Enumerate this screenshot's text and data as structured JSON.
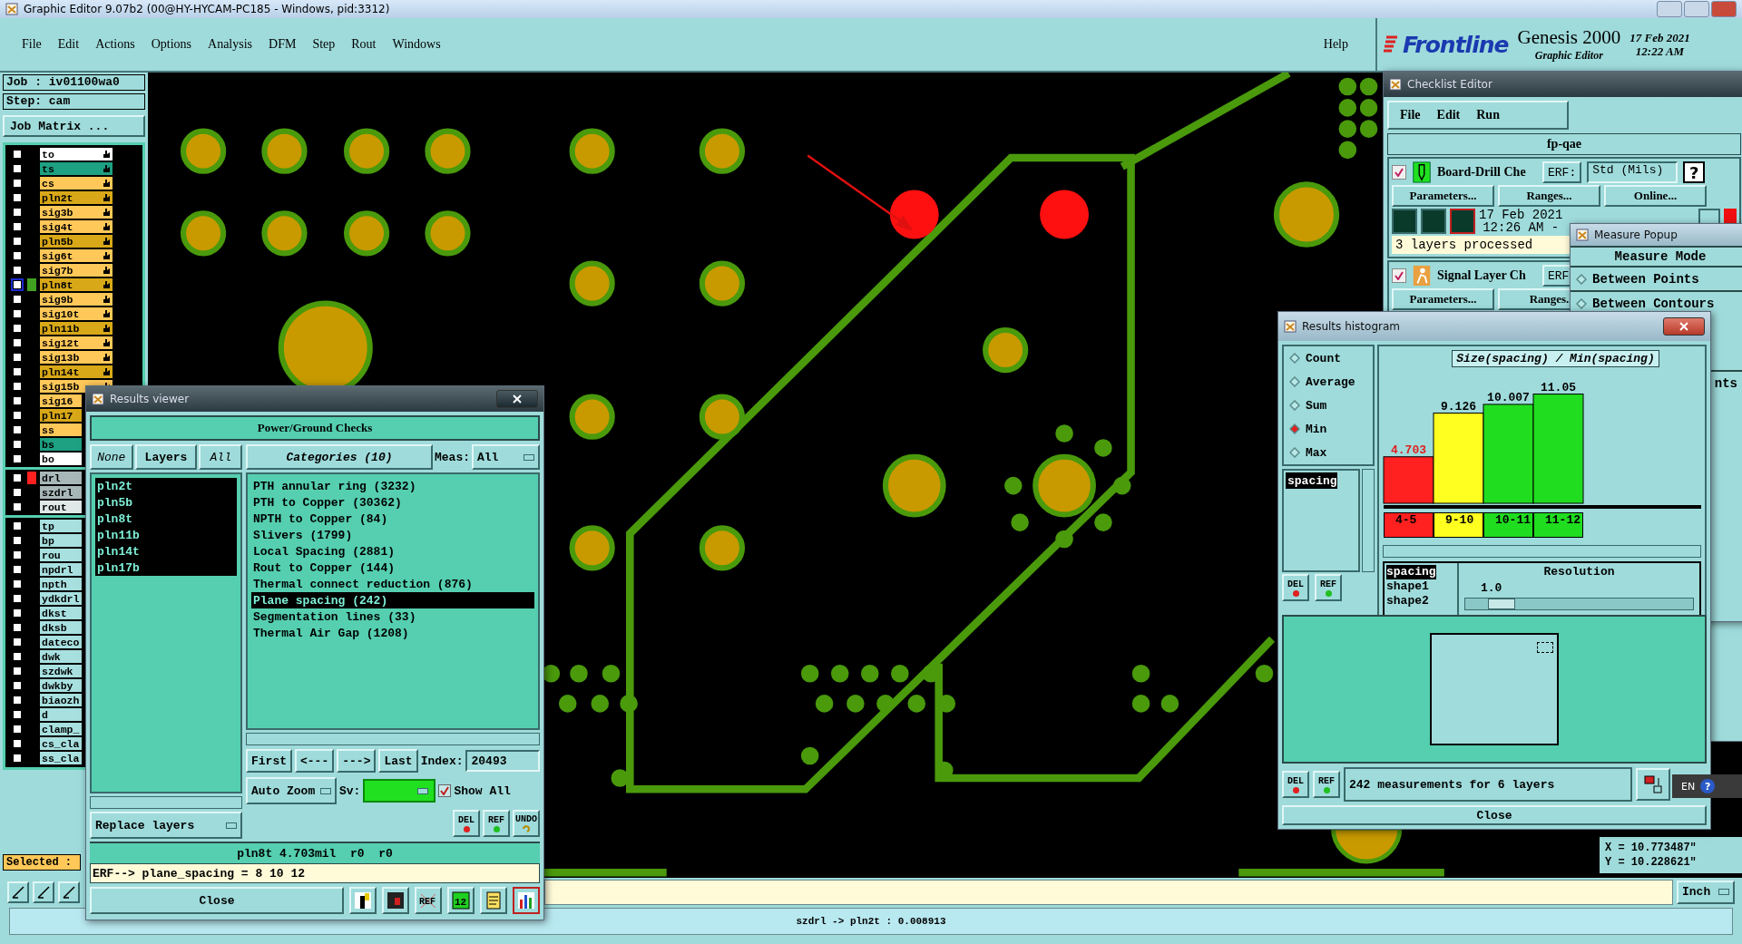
{
  "title_bar": {
    "title": "Graphic Editor 9.07b2 (00@HY-HYCAM-PC185 - Windows, pid:3312)"
  },
  "menu": [
    {
      "label": "File"
    },
    {
      "label": "Edit"
    },
    {
      "label": "Actions"
    },
    {
      "label": "Options"
    },
    {
      "label": "Analysis"
    },
    {
      "label": "DFM"
    },
    {
      "label": "Step"
    },
    {
      "label": "Rout"
    },
    {
      "label": "Windows"
    }
  ],
  "help": "Help",
  "brand": {
    "logo": "Frontline",
    "product": "Genesis 2000",
    "subtitle": "Graphic Editor",
    "date": "17 Feb 2021",
    "time": "12:22 AM"
  },
  "job": {
    "job": "Job : iv01100wa0",
    "step": "Step: cam",
    "matrix_button": "Job Matrix ..."
  },
  "layer_groups": [
    {
      "layers": [
        {
          "name": "to",
          "color": "#ffffff",
          "checked": false,
          "hand": true
        },
        {
          "name": "ts",
          "color": "#1ea082",
          "checked": false,
          "hand": true
        },
        {
          "name": "cs",
          "color": "#ffc858",
          "checked": false,
          "hand": true
        },
        {
          "name": "pln2t",
          "color": "#d8a818",
          "checked": false,
          "hand": true
        },
        {
          "name": "sig3b",
          "color": "#ffc858",
          "checked": false,
          "hand": true
        },
        {
          "name": "sig4t",
          "color": "#ffc858",
          "checked": false,
          "hand": true
        },
        {
          "name": "pln5b",
          "color": "#d8a818",
          "checked": false,
          "hand": true
        },
        {
          "name": "sig6t",
          "color": "#ffc858",
          "checked": false,
          "hand": true
        },
        {
          "name": "sig7b",
          "color": "#ffc858",
          "checked": false,
          "hand": true
        },
        {
          "name": "pln8t",
          "color": "#d8a818",
          "checked": false,
          "hand": true,
          "work": true,
          "marker": {
            "color": "#40a020"
          }
        },
        {
          "name": "sig9b",
          "color": "#ffc858",
          "checked": false,
          "hand": true
        },
        {
          "name": "sig10t",
          "color": "#ffc858",
          "checked": false,
          "hand": true
        },
        {
          "name": "pln11b",
          "color": "#d8a818",
          "checked": false,
          "hand": true
        },
        {
          "name": "sig12t",
          "color": "#ffc858",
          "checked": false,
          "hand": true
        },
        {
          "name": "sig13b",
          "color": "#ffc858",
          "checked": false,
          "hand": true
        },
        {
          "name": "pln14t",
          "color": "#d8a818",
          "checked": false,
          "hand": true
        },
        {
          "name": "sig15b",
          "color": "#ffc858",
          "checked": false,
          "hand": true
        },
        {
          "name": "sig16",
          "color": "#ffc858",
          "checked": false
        },
        {
          "name": "pln17",
          "color": "#d8a818",
          "checked": false
        },
        {
          "name": "ss",
          "color": "#ffc858",
          "checked": false
        },
        {
          "name": "bs",
          "color": "#1ea082",
          "checked": false
        },
        {
          "name": "bo",
          "color": "#ffffff",
          "checked": false
        }
      ]
    },
    {
      "layers": [
        {
          "name": "drl",
          "color": "#a8b8b8",
          "checked": false,
          "marker": {
            "color": "#ff2020"
          }
        },
        {
          "name": "szdrl",
          "color": "#a8b8b8",
          "checked": false
        },
        {
          "name": "rout",
          "color": "#e0e8e8",
          "checked": false
        }
      ]
    },
    {
      "layers": [
        {
          "name": "tp",
          "color": "#a8e0e0",
          "checked": false
        },
        {
          "name": "bp",
          "color": "#a8e0e0",
          "checked": false
        },
        {
          "name": "rou",
          "color": "#a8e0e0",
          "checked": false
        },
        {
          "name": "npdrl",
          "color": "#a8e0e0",
          "checked": false
        },
        {
          "name": "npth",
          "color": "#a8e0e0",
          "checked": false
        },
        {
          "name": "ydkdrl",
          "color": "#a8e0e0",
          "checked": false
        },
        {
          "name": "dkst",
          "color": "#a8e0e0",
          "checked": false
        },
        {
          "name": "dksb",
          "color": "#a8e0e0",
          "checked": false
        },
        {
          "name": "dateco",
          "color": "#a8e0e0",
          "checked": false
        },
        {
          "name": "dwk",
          "color": "#a8e0e0",
          "checked": false
        },
        {
          "name": "szdwk",
          "color": "#a8e0e0",
          "checked": false
        },
        {
          "name": "dwkby",
          "color": "#a8e0e0",
          "checked": false
        },
        {
          "name": "biaozh",
          "color": "#a8e0e0",
          "checked": false
        },
        {
          "name": "d",
          "color": "#a8e0e0",
          "checked": false
        },
        {
          "name": "clamp_",
          "color": "#a8e0e0",
          "checked": false
        },
        {
          "name": "cs_cla",
          "color": "#a8e0e0",
          "checked": false
        },
        {
          "name": "ss_cla",
          "color": "#a8e0e0",
          "checked": false
        }
      ]
    }
  ],
  "selected_label": "Selected :",
  "units": "Inch",
  "coordinates": {
    "x": "X = 10.773487\"",
    "y": "Y = 10.228621\""
  },
  "status": "szdrl -> pln2t : 0.008913",
  "results_viewer": {
    "title": "Results viewer",
    "header": "Power/Ground Checks",
    "layer_buttons": [
      {
        "label": "None",
        "kind": "italic"
      },
      {
        "label": "Layers",
        "kind": "bold"
      },
      {
        "label": "All",
        "kind": "italic"
      }
    ],
    "layers": [
      {
        "name": "pln2t",
        "selected": true
      },
      {
        "name": "pln5b",
        "selected": true
      },
      {
        "name": "pln8t",
        "selected": true
      },
      {
        "name": "pln11b",
        "selected": true
      },
      {
        "name": "pln14t",
        "selected": true
      },
      {
        "name": "pln17b",
        "selected": true
      }
    ],
    "categories_button": "Categories (10)",
    "meas_label": "Meas:",
    "meas_value": "All",
    "categories": [
      {
        "label": "PTH annular ring (3232)",
        "selected": false
      },
      {
        "label": "PTH to Copper (30362)",
        "selected": false
      },
      {
        "label": "NPTH to Copper (84)",
        "selected": false
      },
      {
        "label": "Slivers (1799)",
        "selected": false
      },
      {
        "label": "Local Spacing (2881)",
        "selected": false
      },
      {
        "label": "Rout to Copper (144)",
        "selected": false
      },
      {
        "label": "Thermal connect reduction (876)",
        "selected": false
      },
      {
        "label": "Plane spacing (242)",
        "selected": true
      },
      {
        "label": "Segmentation lines (33)",
        "selected": false
      },
      {
        "label": "Thermal Air Gap (1208)",
        "selected": false
      }
    ],
    "nav_buttons": [
      {
        "label": "First"
      },
      {
        "label": "<---"
      },
      {
        "label": "--->"
      },
      {
        "label": "Last"
      }
    ],
    "index_label": "Index:",
    "index_value": "20493",
    "zoom_mode": "Auto Zoom",
    "sv_label": "Sv:",
    "show_all": {
      "label": "Show All",
      "checked": true
    },
    "action_buttons": [
      {
        "label": "DEL",
        "kind": "del"
      },
      {
        "label": "REF",
        "kind": "ref"
      },
      {
        "label": "UNDO",
        "kind": "undo"
      }
    ],
    "replace_mode": "Replace layers",
    "info": "pln8t 4.703mil  r0  r0",
    "erf_line": "ERF--> plane_spacing = 8 10 12",
    "close": "Close",
    "tools": [
      {
        "kind": "figure",
        "selected": false
      },
      {
        "kind": "exit",
        "selected": false
      },
      {
        "kind": "ref_off",
        "label": "REF",
        "selected": false
      },
      {
        "kind": "numbers",
        "label": "12",
        "selected": false
      },
      {
        "kind": "notes",
        "selected": false
      },
      {
        "kind": "chart",
        "selected": true
      }
    ]
  },
  "checklist_editor": {
    "title": "Checklist Editor",
    "menu": [
      {
        "label": "File"
      },
      {
        "label": "Edit"
      },
      {
        "label": "Run"
      }
    ],
    "checklist": "fp-qae",
    "actions": [
      {
        "checked": true,
        "kind": "drill",
        "name": "Board-Drill Che",
        "erf_label": "ERF:",
        "erf_value": "Std (Mils)",
        "help": "?",
        "buttons": [
          {
            "label": "Parameters..."
          },
          {
            "label": "Ranges..."
          },
          {
            "label": "Online..."
          }
        ],
        "date": "17 Feb 2021",
        "time": "12:26 AM -",
        "status": "3 layers processed"
      },
      {
        "checked": true,
        "kind": "signal",
        "name": "Signal Layer Ch",
        "erf_label": "ERF",
        "buttons": [
          {
            "label": "Parameters..."
          },
          {
            "label": "Ranges."
          }
        ]
      }
    ]
  },
  "measure_popup": {
    "title": "Measure Popup",
    "header": "Measure Mode",
    "modes": [
      {
        "label": "Between Points",
        "selected": false
      },
      {
        "label": "Between Contours",
        "selected": false
      }
    ],
    "partial_option": "nts"
  },
  "histogram": {
    "title": "Results histogram",
    "modes": [
      {
        "label": "Count",
        "selected": false
      },
      {
        "label": "Average",
        "selected": false
      },
      {
        "label": "Sum",
        "selected": false
      },
      {
        "label": "Min",
        "selected": true
      },
      {
        "label": "Max",
        "selected": false
      }
    ],
    "attributes": [
      {
        "label": "spacing",
        "selected": true
      }
    ],
    "side_buttons": [
      {
        "label": "DEL",
        "kind": "del"
      },
      {
        "label": "REF",
        "kind": "ref"
      }
    ],
    "chart_data": {
      "type": "bar",
      "title": "Size(spacing) / Min(spacing)",
      "categories": [
        "4-5",
        "9-10",
        "10-11",
        "11-12"
      ],
      "values": [
        4.703,
        9.126,
        10.007,
        11.05
      ],
      "data_labels": true
    },
    "bins": [
      {
        "color": "#ff2020",
        "alert": true
      },
      {
        "color": "#ffff20",
        "alert": false
      },
      {
        "color": "#20dd20",
        "alert": false
      },
      {
        "color": "#20dd20",
        "alert": false
      }
    ],
    "fields": [
      {
        "label": "spacing",
        "selected": true
      },
      {
        "label": "shape1",
        "selected": false
      },
      {
        "label": "shape2",
        "selected": false
      }
    ],
    "resolution": {
      "label": "Resolution",
      "value": "1.0",
      "level": 0.1
    },
    "footer_buttons": [
      {
        "label": "DEL",
        "kind": "del"
      },
      {
        "label": "REF",
        "kind": "ref"
      }
    ],
    "summary": "242 measurements for 6 layers",
    "close": "Close"
  },
  "ime": {
    "language": "EN",
    "help": "?"
  }
}
